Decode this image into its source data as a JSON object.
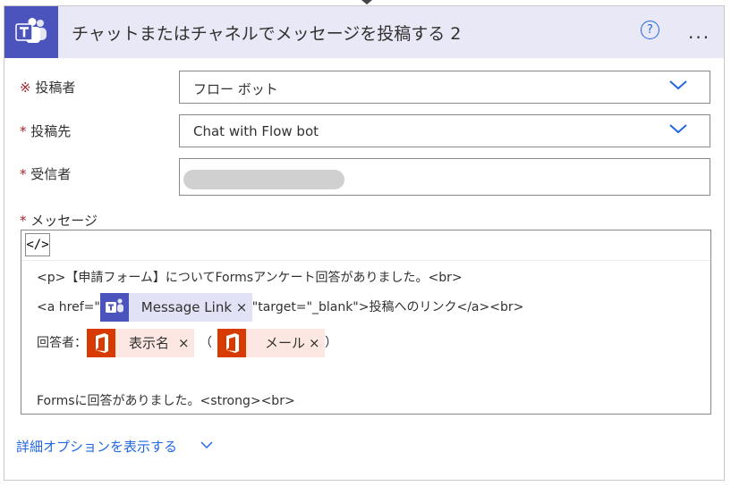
{
  "header": {
    "title": "チャットまたはチャネルでメッセージを投稿する 2",
    "help_glyph": "?",
    "more_glyph": "..."
  },
  "fields": {
    "poster": {
      "required_mark": "※",
      "label": "投稿者",
      "value": "フロー ボット"
    },
    "post_in": {
      "required_mark": "*",
      "label": "投稿先",
      "value": "Chat with Flow bot"
    },
    "recipient": {
      "required_mark": "*",
      "label": "受信者",
      "value": ""
    },
    "message": {
      "required_mark": "*",
      "label": "メッセージ"
    }
  },
  "editor": {
    "code_toggle_glyph": "</>",
    "line1": "<p>【申請フォーム】についてFormsアンケート回答がありました。<br>",
    "line2_pre": "<a href=\"",
    "line2_token": "Message Link",
    "line2_post": "\"target=\"_blank\">投稿へのリンク</a><br>",
    "line3_label": "回答者：",
    "line3_token1": "表示名",
    "line3_open": "（",
    "line3_token2": "メール",
    "line3_close": "）",
    "line5": "Formsに回答がありました。<strong><br>",
    "token_remove_glyph": "×"
  },
  "advanced_options": {
    "label": "詳細オプションを表示する"
  },
  "colors": {
    "teams_purple": "#4b53bc",
    "office_orange": "#d83b01",
    "link_blue": "#2266e3",
    "required_red": "#a4262c"
  }
}
